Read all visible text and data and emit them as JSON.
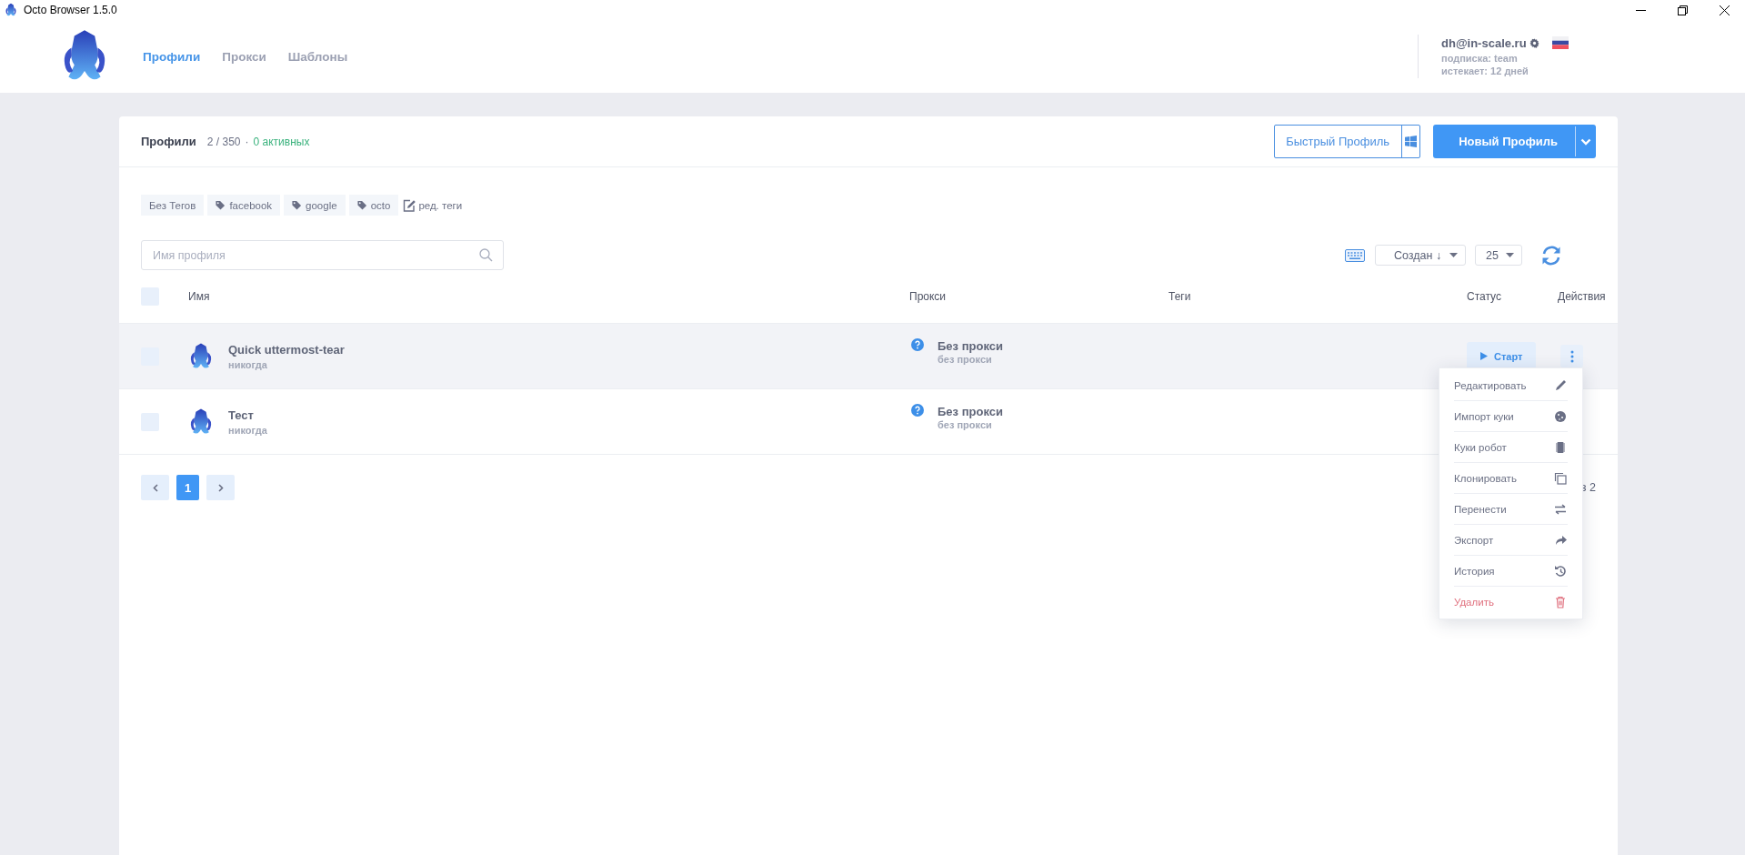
{
  "window": {
    "title": "Octo Browser 1.5.0"
  },
  "nav": {
    "tabs": [
      {
        "label": "Профили",
        "selected": true
      },
      {
        "label": "Прокси",
        "selected": false
      },
      {
        "label": "Шаблоны",
        "selected": false
      }
    ]
  },
  "account": {
    "email": "dh@in-scale.ru",
    "subscription": "подписка: team",
    "expires": "истекает: 12 дней"
  },
  "profiles_panel": {
    "title": "Профили",
    "count": "2 / 350",
    "separator": "·",
    "active": "0 активных",
    "quick_button": "Быстрый Профиль",
    "new_button": "Новый Профиль"
  },
  "tags": [
    {
      "label": "Без Тегов",
      "kind": "plain"
    },
    {
      "label": "facebook",
      "kind": "tag"
    },
    {
      "label": "google",
      "kind": "tag"
    },
    {
      "label": "octo",
      "kind": "tag"
    }
  ],
  "edit_tags": "ред. теги",
  "search": {
    "placeholder": "Имя профиля"
  },
  "sort": {
    "value": "Создан ↓"
  },
  "per_page": {
    "value": "25"
  },
  "table": {
    "select_all_checked": false,
    "columns": [
      "Имя",
      "Прокси",
      "Теги",
      "Статус",
      "Действия"
    ],
    "rows": [
      {
        "name": "Quick uttermost-tear",
        "last_run": "никогда",
        "proxy": "Без прокси",
        "proxy_detail": "без прокси",
        "checked": false,
        "hovered": true,
        "start_button": "Старт"
      },
      {
        "name": "Тест",
        "last_run": "никогда",
        "proxy": "Без прокси",
        "proxy_detail": "без прокси",
        "checked": false,
        "hovered": false
      }
    ]
  },
  "pagination": {
    "pages": [
      {
        "label": "1",
        "selected": true
      }
    ],
    "range_text": "з 2"
  },
  "context_menu": {
    "items": [
      {
        "label": "Редактировать",
        "kind": "edit"
      },
      {
        "label": "Импорт куки",
        "kind": "cookie"
      },
      {
        "label": "Куки робот",
        "kind": "chip"
      },
      {
        "label": "Клонировать",
        "kind": "clone"
      },
      {
        "label": "Перенести",
        "kind": "transfer"
      },
      {
        "label": "Экспорт",
        "kind": "export"
      },
      {
        "label": "История",
        "kind": "history"
      },
      {
        "label": "Удалить",
        "kind": "delete"
      }
    ]
  }
}
